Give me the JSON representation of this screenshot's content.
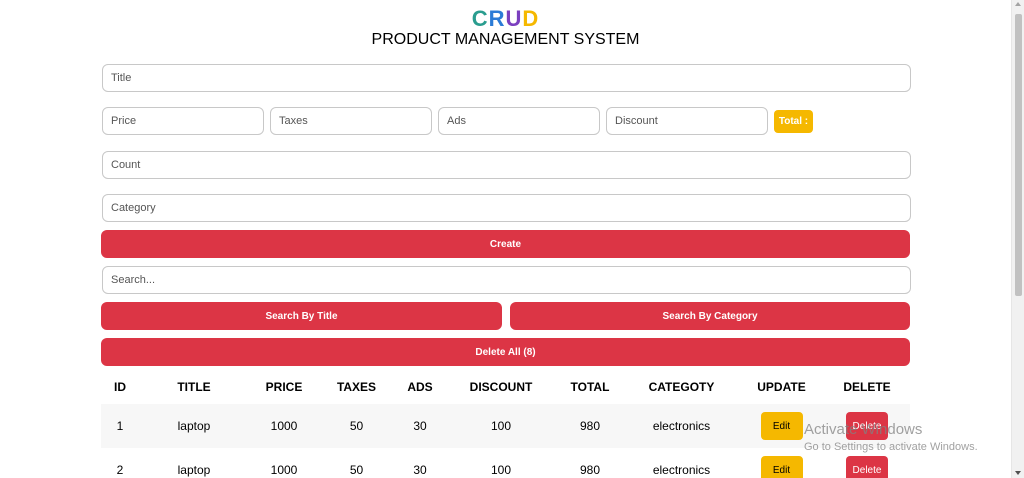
{
  "header": {
    "logo_letters": [
      {
        "char": "C",
        "color": "#2a9d8f"
      },
      {
        "char": "R",
        "color": "#2b7bd6"
      },
      {
        "char": "U",
        "color": "#7b3fbf"
      },
      {
        "char": "D",
        "color": "#f5b800"
      }
    ],
    "subtitle": "PRODUCT MANAGEMENT SYSTEM"
  },
  "form": {
    "title_placeholder": "Title",
    "price_placeholder": "Price",
    "taxes_placeholder": "Taxes",
    "ads_placeholder": "Ads",
    "discount_placeholder": "Discount",
    "total_label": "Total :",
    "count_placeholder": "Count",
    "category_placeholder": "Category",
    "create_label": "Create"
  },
  "search": {
    "placeholder": "Search...",
    "by_title_label": "Search By Title",
    "by_category_label": "Search By Category",
    "delete_all_label": "Delete All (8)"
  },
  "table": {
    "headers": [
      "ID",
      "TITLE",
      "PRICE",
      "TAXES",
      "ADS",
      "DISCOUNT",
      "TOTAL",
      "CATEGOTY",
      "UPDATE",
      "DELETE"
    ],
    "rows": [
      {
        "id": "1",
        "title": "laptop",
        "price": "1000",
        "taxes": "50",
        "ads": "30",
        "discount": "100",
        "total": "980",
        "category": "electronics",
        "edit": "Edit",
        "delete": "Delete"
      },
      {
        "id": "2",
        "title": "laptop",
        "price": "1000",
        "taxes": "50",
        "ads": "30",
        "discount": "100",
        "total": "980",
        "category": "electronics",
        "edit": "Edit",
        "delete": "Delete"
      }
    ]
  },
  "watermark": {
    "title": "Activate Windows",
    "subtitle": "Go to Settings to activate Windows."
  },
  "colors": {
    "accent_red": "#dc3545",
    "accent_yellow": "#f5b800"
  }
}
